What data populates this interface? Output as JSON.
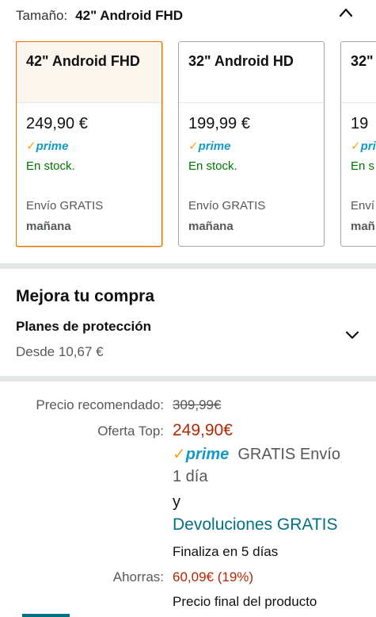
{
  "size_selector": {
    "label": "Tamaño:",
    "selected": "42\" Android FHD",
    "collapse_icon": "chevron-up-icon"
  },
  "swatches": [
    {
      "title": "42\" Android FHD",
      "price": "249,90 €",
      "prime_check": "✓",
      "prime_word": "prime",
      "stock": "En stock.",
      "shipping": "Envío GRATIS",
      "shipping_day": "mañana",
      "selected": true
    },
    {
      "title": "32\" Android HD",
      "price": "199,99 €",
      "prime_check": "✓",
      "prime_word": "prime",
      "stock": "En stock.",
      "shipping": "Envío GRATIS",
      "shipping_day": "mañana",
      "selected": false
    },
    {
      "title": "32\"",
      "price": "19",
      "prime_check": "✓",
      "prime_word": "pri",
      "stock": "En s",
      "shipping": "Enví",
      "shipping_day": "mañ",
      "selected": false
    }
  ],
  "upgrade": {
    "title": "Mejora tu compra",
    "plans_title": "Planes de protección",
    "plans_from": "Desde 10,67 €",
    "chevron_icon": "chevron-down-icon"
  },
  "pricing": {
    "list_label": "Precio recomendado:",
    "list_price": "309,99€",
    "deal_label": "Oferta Top:",
    "deal_price": "249,90€",
    "prime_check": "✓",
    "prime_word": "prime",
    "free_shipping_line1": "GRATIS Envío",
    "free_shipping_line2": "1 día",
    "and": "y",
    "returns": "Devoluciones GRATIS",
    "ends_in": "Finaliza en 5 días",
    "savings_label": "Ahorras:",
    "savings_value": "60,09€ (19%)",
    "final_price_note": "Precio final del producto"
  },
  "colors": {
    "accent_orange": "#e77600",
    "price_red": "#b12704",
    "stock_green": "#007600",
    "prime_blue": "#1399c6",
    "link_teal": "#007185",
    "divider_gray": "#e3e6e6"
  }
}
